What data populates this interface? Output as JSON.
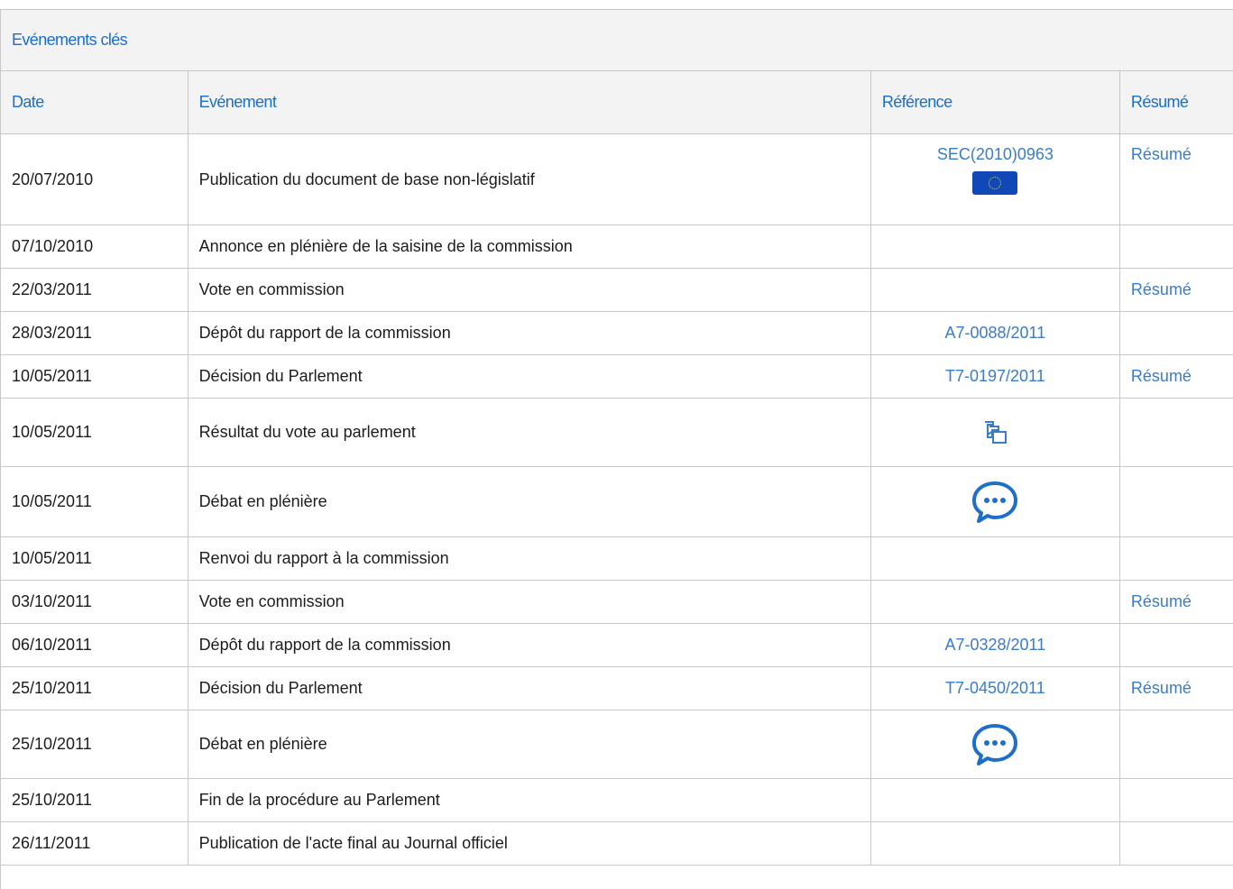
{
  "panel": {
    "title": "Evénements clés"
  },
  "columns": {
    "date": "Date",
    "event": "Evénement",
    "reference": "Référence",
    "summary": "Résumé"
  },
  "rows": [
    {
      "date": "20/07/2010",
      "event": "Publication du document de base non-législatif",
      "reference": "SEC(2010)0963",
      "reference_icon": "eu-flag-icon",
      "summary": "Résumé"
    },
    {
      "date": "07/10/2010",
      "event": "Annonce en plénière de la saisine de la commission",
      "reference": "",
      "summary": ""
    },
    {
      "date": "22/03/2011",
      "event": "Vote en commission",
      "reference": "",
      "summary": "Résumé"
    },
    {
      "date": "28/03/2011",
      "event": "Dépôt du rapport de la commission",
      "reference": "A7-0088/2011",
      "summary": ""
    },
    {
      "date": "10/05/2011",
      "event": "Décision du Parlement",
      "reference": "T7-0197/2011",
      "summary": "Résumé"
    },
    {
      "date": "10/05/2011",
      "event": "Résultat du vote au parlement",
      "reference_icon": "vote-result-icon",
      "summary": ""
    },
    {
      "date": "10/05/2011",
      "event": "Débat en plénière",
      "reference_icon": "debate-chat-icon",
      "summary": ""
    },
    {
      "date": "10/05/2011",
      "event": "Renvoi du rapport à la commission",
      "reference": "",
      "summary": ""
    },
    {
      "date": "03/10/2011",
      "event": "Vote en commission",
      "reference": "",
      "summary": "Résumé"
    },
    {
      "date": "06/10/2011",
      "event": "Dépôt du rapport de la commission",
      "reference": "A7-0328/2011",
      "summary": ""
    },
    {
      "date": "25/10/2011",
      "event": "Décision du Parlement",
      "reference": "T7-0450/2011",
      "summary": "Résumé"
    },
    {
      "date": "25/10/2011",
      "event": "Débat en plénière",
      "reference_icon": "debate-chat-icon",
      "summary": ""
    },
    {
      "date": "25/10/2011",
      "event": "Fin de la procédure au Parlement",
      "reference": "",
      "summary": ""
    },
    {
      "date": "26/11/2011",
      "event": "Publication de l'acte final au Journal officiel",
      "reference": "",
      "summary": ""
    }
  ],
  "colors": {
    "link": "#3a7cc7",
    "header_text": "#1a6fc9",
    "header_bg": "#f3f3f3",
    "border": "#c8c8c8"
  }
}
